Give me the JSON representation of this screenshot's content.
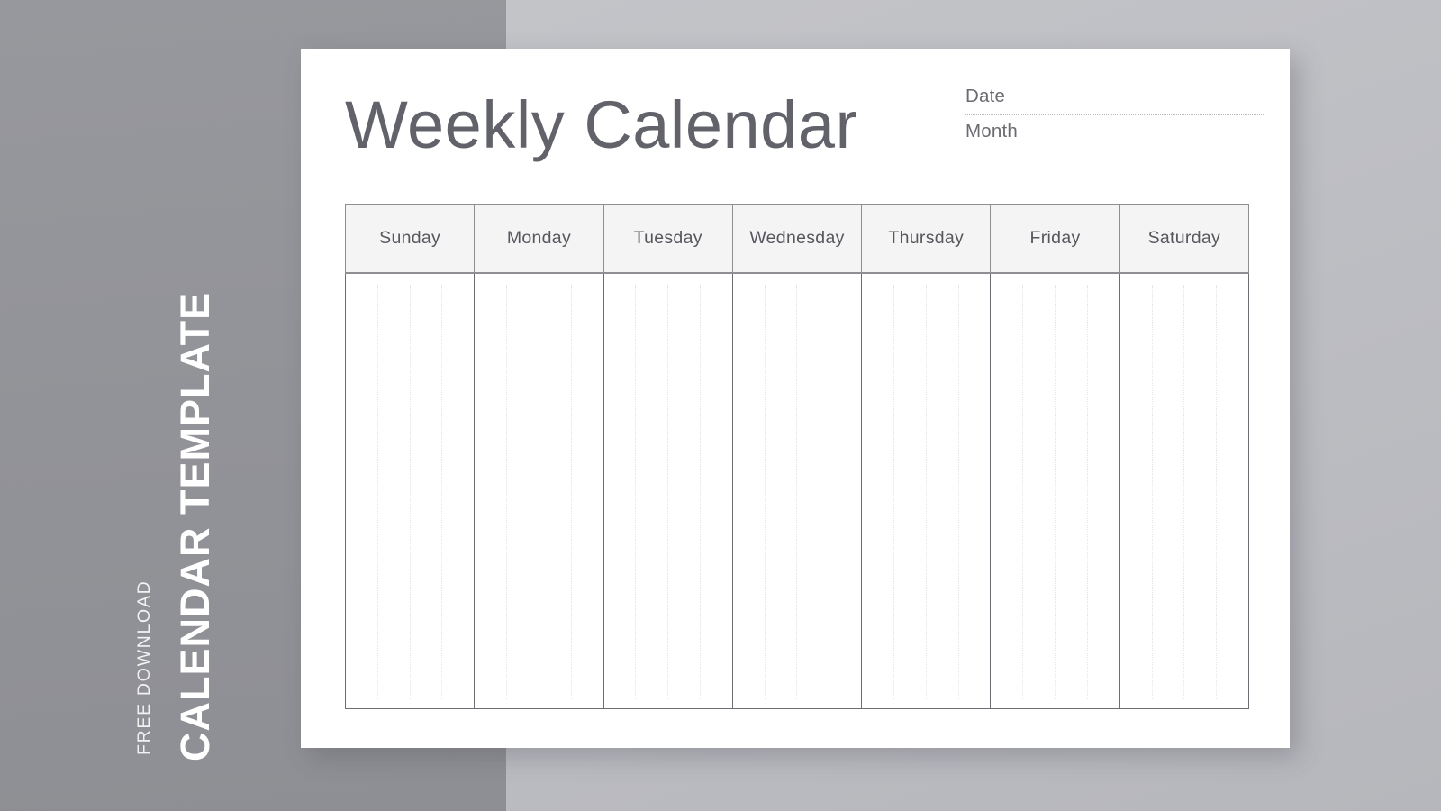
{
  "promo": {
    "subtitle": "FREE DOWNLOAD",
    "title": "CALENDAR TEMPLATE",
    "text_color": "#ffffff",
    "panel_color": "#929398"
  },
  "document": {
    "title": "Weekly Calendar",
    "title_color": "#62636a",
    "background": "#ffffff",
    "meta_fields": [
      {
        "label": "Date",
        "value": ""
      },
      {
        "label": "Month",
        "value": ""
      }
    ]
  },
  "calendar": {
    "day_headers": [
      "Sunday",
      "Monday",
      "Tuesday",
      "Wednesday",
      "Thursday",
      "Friday",
      "Saturday"
    ],
    "header_fill": "#f4f4f5",
    "border_color": "#6d6e73",
    "guide_line_color": "#e4e4e6",
    "guides_per_cell": 3,
    "cells": [
      "",
      "",
      "",
      "",
      "",
      "",
      ""
    ]
  },
  "page": {
    "background_left": "#929398",
    "background_right": "#bfc0c4"
  }
}
